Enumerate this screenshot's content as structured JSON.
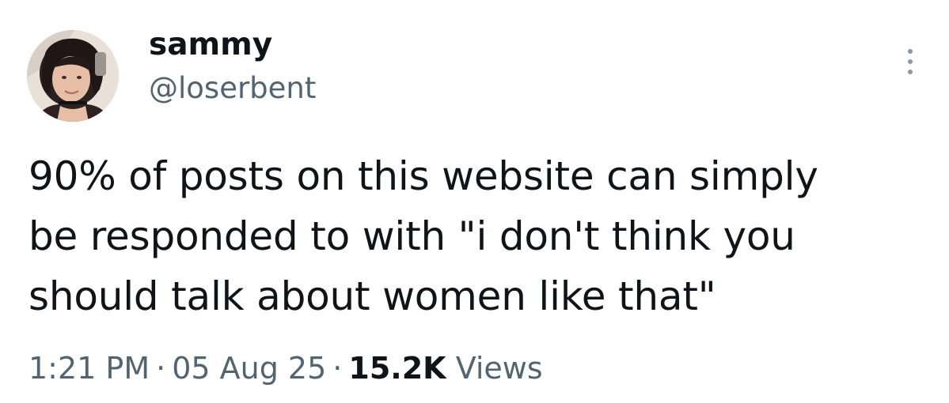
{
  "tweet": {
    "author": {
      "display_name": "sammy",
      "handle": "@loserbent",
      "avatar_icon": "profile-photo"
    },
    "more_icon": "more-options-vertical-dots",
    "text_lines": [
      "90% of posts on this website can simply",
      "be responded to with \"i don't think you",
      "should talk about women like that\""
    ],
    "meta": {
      "time": "1:21 PM",
      "date": "05 Aug 25",
      "separator": "·",
      "views_count": "15.2K",
      "views_label": "Views"
    },
    "colors": {
      "text": "#0f1419",
      "secondary": "#536471",
      "background": "#ffffff"
    }
  }
}
